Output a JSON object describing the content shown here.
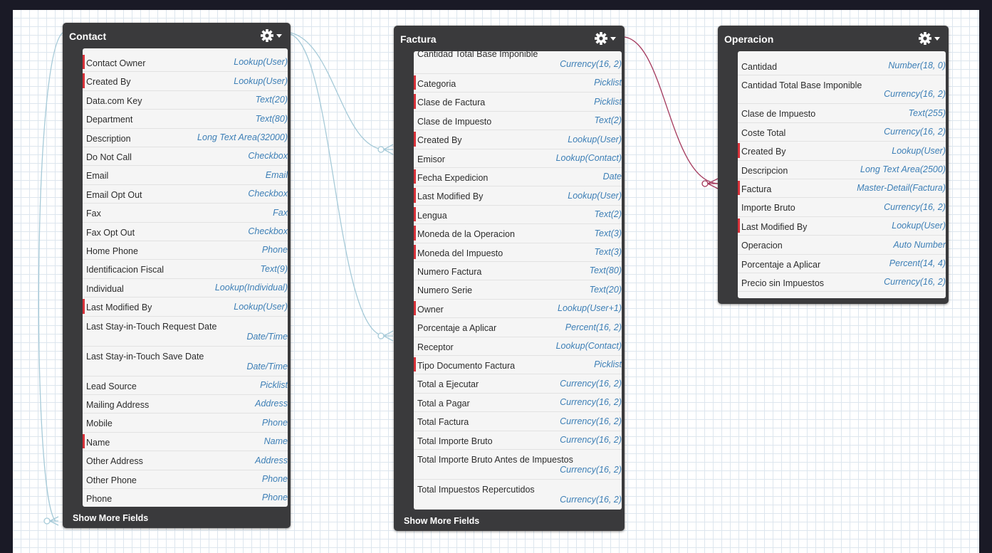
{
  "objects": [
    {
      "id": "contact",
      "title": "Contact",
      "show_more_label": "Show More Fields",
      "fields": [
        {
          "name": "Contact Owner",
          "type": "Lookup(User)",
          "required": true
        },
        {
          "name": "Created By",
          "type": "Lookup(User)",
          "required": true
        },
        {
          "name": "Data.com Key",
          "type": "Text(20)",
          "required": false
        },
        {
          "name": "Department",
          "type": "Text(80)",
          "required": false
        },
        {
          "name": "Description",
          "type": "Long Text Area(32000)",
          "required": false
        },
        {
          "name": "Do Not Call",
          "type": "Checkbox",
          "required": false
        },
        {
          "name": "Email",
          "type": "Email",
          "required": false
        },
        {
          "name": "Email Opt Out",
          "type": "Checkbox",
          "required": false
        },
        {
          "name": "Fax",
          "type": "Fax",
          "required": false
        },
        {
          "name": "Fax Opt Out",
          "type": "Checkbox",
          "required": false
        },
        {
          "name": "Home Phone",
          "type": "Phone",
          "required": false
        },
        {
          "name": "Identificacion Fiscal",
          "type": "Text(9)",
          "required": false
        },
        {
          "name": "Individual",
          "type": "Lookup(Individual)",
          "required": false
        },
        {
          "name": "Last Modified By",
          "type": "Lookup(User)",
          "required": true
        },
        {
          "name": "Last Stay-in-Touch Request Date",
          "type": "Date/Time",
          "required": false,
          "tall": true
        },
        {
          "name": "Last Stay-in-Touch Save Date",
          "type": "Date/Time",
          "required": false,
          "tall": true
        },
        {
          "name": "Lead Source",
          "type": "Picklist",
          "required": false
        },
        {
          "name": "Mailing Address",
          "type": "Address",
          "required": false
        },
        {
          "name": "Mobile",
          "type": "Phone",
          "required": false
        },
        {
          "name": "Name",
          "type": "Name",
          "required": true
        },
        {
          "name": "Other Address",
          "type": "Address",
          "required": false
        },
        {
          "name": "Other Phone",
          "type": "Phone",
          "required": false
        },
        {
          "name": "Phone",
          "type": "Phone",
          "required": false
        }
      ]
    },
    {
      "id": "factura",
      "title": "Factura",
      "show_more_label": "Show More Fields",
      "fields": [
        {
          "name": "Cantidad Total Base Imponible",
          "type": "Currency(16, 2)",
          "required": false,
          "tall": true
        },
        {
          "name": "Categoria",
          "type": "Picklist",
          "required": true
        },
        {
          "name": "Clase de Factura",
          "type": "Picklist",
          "required": true
        },
        {
          "name": "Clase de Impuesto",
          "type": "Text(2)",
          "required": false
        },
        {
          "name": "Created By",
          "type": "Lookup(User)",
          "required": true
        },
        {
          "name": "Emisor",
          "type": "Lookup(Contact)",
          "required": false
        },
        {
          "name": "Fecha Expedicion",
          "type": "Date",
          "required": true
        },
        {
          "name": "Last Modified By",
          "type": "Lookup(User)",
          "required": true
        },
        {
          "name": "Lengua",
          "type": "Text(2)",
          "required": true
        },
        {
          "name": "Moneda de la Operacion",
          "type": "Text(3)",
          "required": true
        },
        {
          "name": "Moneda del Impuesto",
          "type": "Text(3)",
          "required": true
        },
        {
          "name": "Numero Factura",
          "type": "Text(80)",
          "required": false
        },
        {
          "name": "Numero Serie",
          "type": "Text(20)",
          "required": false
        },
        {
          "name": "Owner",
          "type": "Lookup(User+1)",
          "required": true
        },
        {
          "name": "Porcentaje a Aplicar",
          "type": "Percent(16, 2)",
          "required": false
        },
        {
          "name": "Receptor",
          "type": "Lookup(Contact)",
          "required": false
        },
        {
          "name": "Tipo Documento Factura",
          "type": "Picklist",
          "required": true
        },
        {
          "name": "Total a Ejecutar",
          "type": "Currency(16, 2)",
          "required": false
        },
        {
          "name": "Total a Pagar",
          "type": "Currency(16, 2)",
          "required": false
        },
        {
          "name": "Total Factura",
          "type": "Currency(16, 2)",
          "required": false
        },
        {
          "name": "Total Importe Bruto",
          "type": "Currency(16, 2)",
          "required": false
        },
        {
          "name": "Total Importe Bruto Antes de Impuestos",
          "type": "Currency(16, 2)",
          "required": false,
          "tall": true
        },
        {
          "name": "Total Impuestos Repercutidos",
          "type": "Currency(16, 2)",
          "required": false,
          "tall": true
        }
      ]
    },
    {
      "id": "operacion",
      "title": "Operacion",
      "fields": [
        {
          "name": "Cantidad",
          "type": "Number(18, 0)",
          "required": false
        },
        {
          "name": "Cantidad Total Base Imponible",
          "type": "Currency(16, 2)",
          "required": false,
          "tall": true
        },
        {
          "name": "Clase de Impuesto",
          "type": "Text(255)",
          "required": false
        },
        {
          "name": "Coste Total",
          "type": "Currency(16, 2)",
          "required": false
        },
        {
          "name": "Created By",
          "type": "Lookup(User)",
          "required": true
        },
        {
          "name": "Descripcion",
          "type": "Long Text Area(2500)",
          "required": false
        },
        {
          "name": "Factura",
          "type": "Master-Detail(Factura)",
          "required": true
        },
        {
          "name": "Importe Bruto",
          "type": "Currency(16, 2)",
          "required": false
        },
        {
          "name": "Last Modified By",
          "type": "Lookup(User)",
          "required": true
        },
        {
          "name": "Operacion",
          "type": "Auto Number",
          "required": false
        },
        {
          "name": "Porcentaje a Aplicar",
          "type": "Percent(14, 4)",
          "required": false
        },
        {
          "name": "Precio sin Impuestos",
          "type": "Currency(16, 2)",
          "required": false
        }
      ]
    }
  ],
  "colors": {
    "lookup_line": "#a6cad8",
    "master_detail_line": "#a3385c",
    "required_marker": "#d8323a",
    "header_bg": "#3a3a3c",
    "type_text": "#3d7fb6"
  }
}
